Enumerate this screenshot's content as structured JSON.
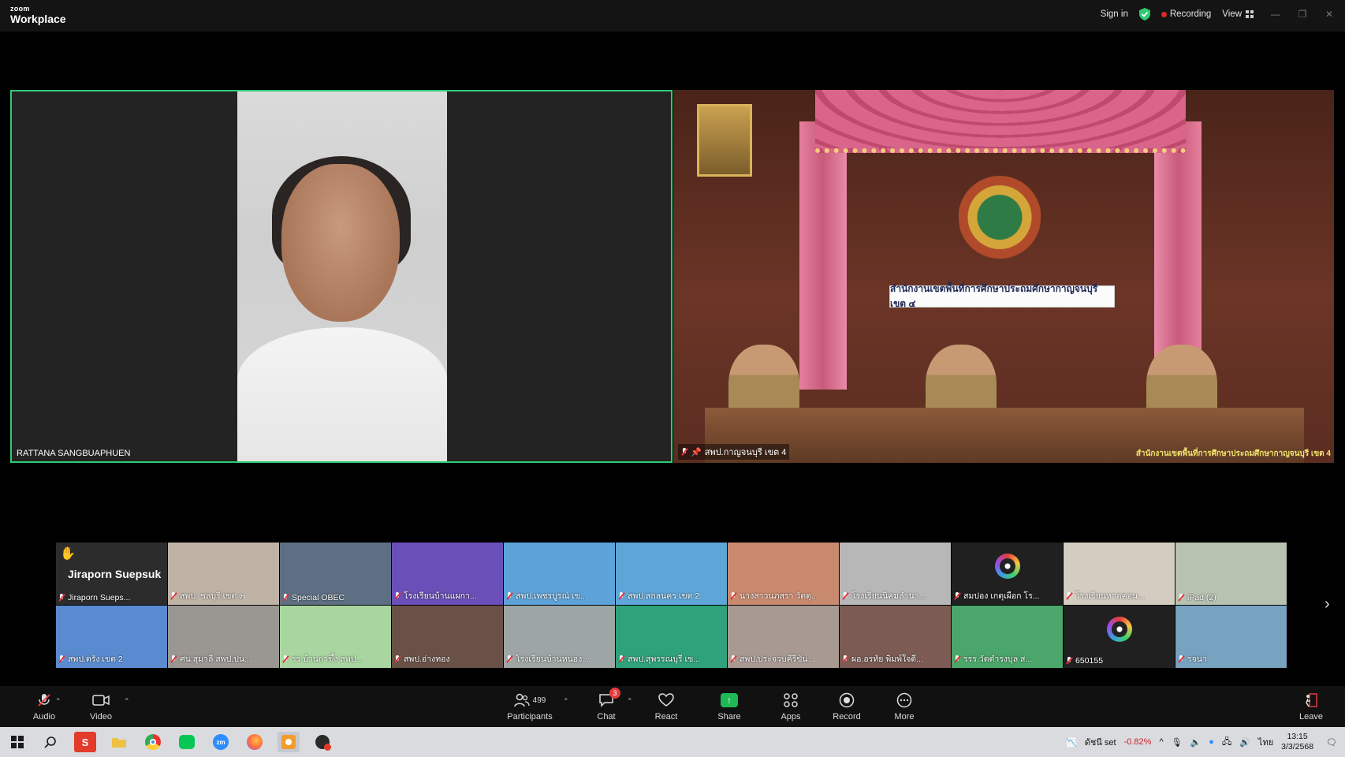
{
  "app": {
    "logo_small": "zoom",
    "logo_big": "Workplace"
  },
  "topbar": {
    "sign_in": "Sign in",
    "recording": "Recording",
    "view": "View"
  },
  "speakers": [
    {
      "name": "RATTANA SANGBUAPHUEN"
    },
    {
      "name": "สพป.กาญจนบุรี เขต 4",
      "sign": "สำนักงานเขตพื้นที่การศึกษาประถมศึกษากาญจนบุรี เขต ๔",
      "watermark": "สำนักงานเขตพื้นที่การศึกษาประถมศึกษากาญจนบุรี เขต 4"
    }
  ],
  "gallery": {
    "row1": [
      {
        "name": "Jiraporn  Sueps...",
        "big_name": "Jiraporn  Suepsuk",
        "hand": "✋"
      },
      {
        "name": "สพป. ชลบุรี เขต ๓"
      },
      {
        "name": "Special OBEC"
      },
      {
        "name": "โรงเรียนบ้านแผกา..."
      },
      {
        "name": "สพป.เพชรบูรณ์ เข..."
      },
      {
        "name": "สพป.สกลนคร เขต 2"
      },
      {
        "name": "นางสาวนภสรา วัตตุ..."
      },
      {
        "name": "โรงเรียนนิคมลำนา..."
      },
      {
        "name": "สมปอง เกตุเผือก โร..."
      },
      {
        "name": "โรงเรียนหาดคอน..."
      },
      {
        "name": "iPad (2)"
      }
    ],
    "row2": [
      {
        "name": "สพป.ตรัง เขต 2"
      },
      {
        "name": "ศน.สุมาลี  สพป.ปน..."
      },
      {
        "name": "รร.บ้านกาขึ้ง สพป..."
      },
      {
        "name": "สพป.อ่างทอง"
      },
      {
        "name": "โรงเรียนบ้านหนอง..."
      },
      {
        "name": "สพป.สุพรรณบุรี เข..."
      },
      {
        "name": "สพป.ประจวบคีรีขัน..."
      },
      {
        "name": "ผอ.อรทัย พิมพ์ใจดี..."
      },
      {
        "name": "รรร.วัดตำรงบุล  ส..."
      },
      {
        "name": "650155"
      },
      {
        "name": "รจนา"
      }
    ]
  },
  "toolbar": {
    "audio": "Audio",
    "video": "Video",
    "participants": "Participants",
    "participants_count": "499",
    "chat": "Chat",
    "chat_badge": "3",
    "react": "React",
    "share": "Share",
    "apps": "Apps",
    "record": "Record",
    "more": "More",
    "leave": "Leave"
  },
  "taskbar": {
    "stock_name": "ดัชนี set",
    "stock_change": "-0.82%",
    "lang": "ไทย",
    "time": "13:15",
    "date": "3/3/2568"
  }
}
